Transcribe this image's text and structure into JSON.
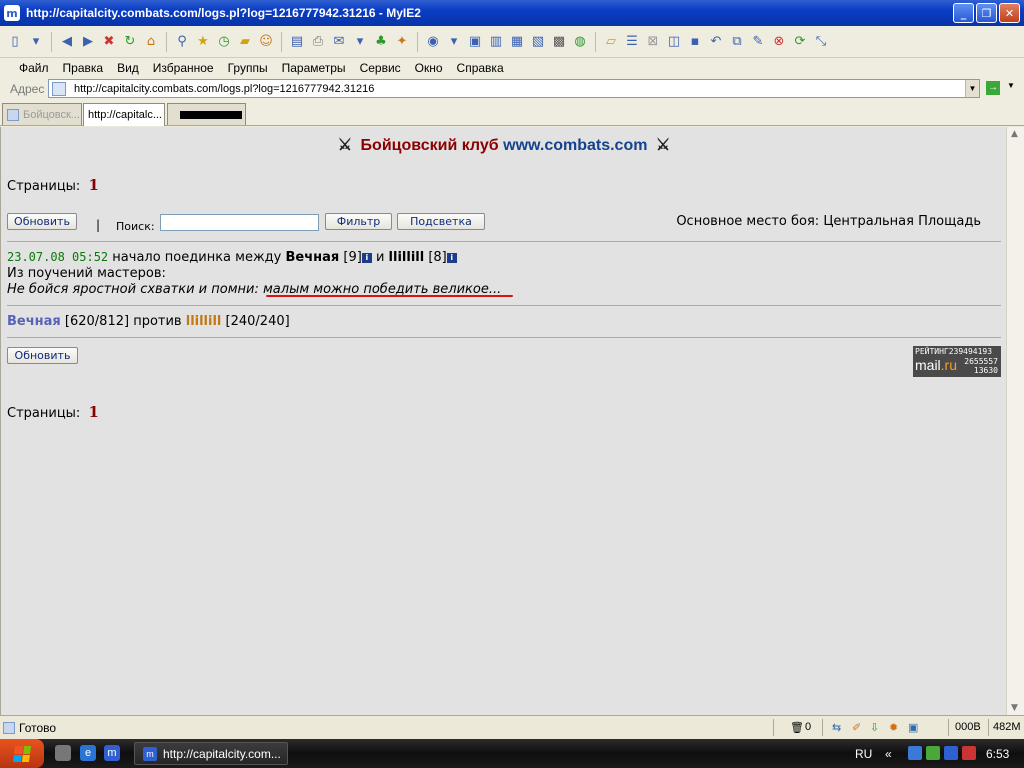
{
  "window": {
    "title": "http://capitalcity.combats.com/logs.pl?log=1216777942.31216 - MyIE2",
    "app_icon": "m",
    "buttons": [
      "minimize-icon",
      "restore-icon",
      "close-icon"
    ],
    "minimize_glyph": "_",
    "restore_glyph": "❐",
    "close_glyph": "✕"
  },
  "menu": [
    "Файл",
    "Правка",
    "Вид",
    "Избранное",
    "Группы",
    "Параметры",
    "Сервис",
    "Окно",
    "Справка"
  ],
  "address": {
    "label": "Адрес",
    "url": "http://capitalcity.combats.com/logs.pl?log=1216777942.31216",
    "dropdown_glyph": "▼",
    "go_glyph": "→"
  },
  "tabs": [
    {
      "label": "Бойцовск...",
      "active": false
    },
    {
      "label": "http://capitalc...",
      "active": true
    },
    {
      "label": "",
      "active": false,
      "redacted": true
    }
  ],
  "page": {
    "header_red": "Бойцовский клуб",
    "header_blue": "www.combats.com",
    "swords_glyph": "⚔",
    "pages_label": "Страницы:",
    "pages_number": "1",
    "refresh_label": "Обновить",
    "pipe": "|",
    "search_label": "Поиск:",
    "search_value": "",
    "filter_label": "Фильтр",
    "highlight_label": "Подсветка",
    "battle_place": "Основное место боя: Центральная Площадь",
    "log": {
      "date": "23.07.08 05:52",
      "start_text": "начало поединка между",
      "fighter1": "Вечная",
      "fighter1_level": "[9]",
      "and_text": "и",
      "fighter2": "llillill",
      "fighter2_level": "[8]",
      "info_glyph": "i",
      "masters_line": "Из поучений мастеров:",
      "quote_start": "Не бойся яростной схватки и помни:",
      "quote_end": "малым можно победить великое..."
    },
    "hp": {
      "fighter1": "Вечная",
      "fighter1_hp": "[620/812]",
      "versus": "против",
      "fighter2": "llillill",
      "fighter2_hp": "[240/240]"
    },
    "refresh_label_bottom": "Обновить",
    "rating": {
      "top": "РЕЙТИНГ239494193",
      "brand_main": "mail",
      "brand_dot": ".ru",
      "n1": "2655557",
      "n2": "13630"
    },
    "pages_label_bottom": "Страницы:",
    "pages_number_bottom": "1"
  },
  "statusbar": {
    "status": "Готово",
    "popup_count": "0",
    "traffic": "000B",
    "memory": "482M"
  },
  "taskbar": {
    "task_label": "http://capitalcity.com...",
    "lang": "RU",
    "clock": "6:53",
    "tray_chevron": "«"
  },
  "colors": {
    "header_red": "#8b0000",
    "header_blue": "#13428e",
    "date_green": "#0a7a0a",
    "fighter1": "#5a62b8",
    "fighter2": "#c27a17",
    "underline": "#dd1111"
  }
}
